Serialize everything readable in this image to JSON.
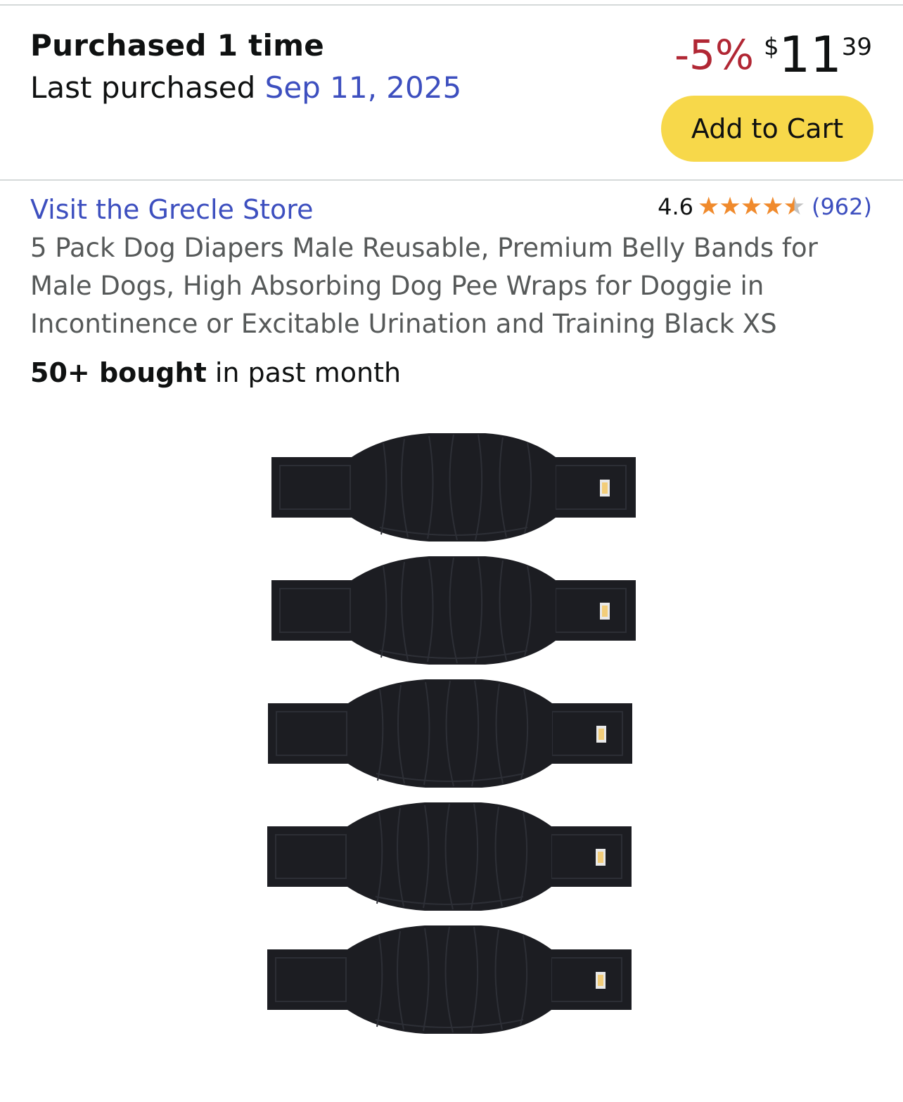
{
  "purchase_history": {
    "purchased_count": "Purchased 1 time",
    "last_purchased_label": "Last purchased",
    "last_purchased_date": "Sep 11, 2025"
  },
  "price": {
    "discount": "-5%",
    "currency_symbol": "$",
    "whole": "11",
    "fraction": "39"
  },
  "cart": {
    "add_to_cart_label": "Add to Cart",
    "button_color": "#f7d84a"
  },
  "product": {
    "store_link": "Visit the Grecle Store",
    "rating": "4.6",
    "stars": 4.6,
    "review_count": "(962)",
    "title": "5 Pack Dog Diapers Male Reusable, Premium Belly Bands for Male Dogs, High Absorbing Dog Pee Wraps for Doggie in Incontinence or Excitable Urination and Training Black XS",
    "bought_bold": "50+ bought",
    "bought_rest": "in past month",
    "image_description_icon": "belly-band-image"
  },
  "colors": {
    "link": "#3d4fbf",
    "discount": "#b12734",
    "star": "#f08a2c",
    "band": "#1c1d22"
  }
}
